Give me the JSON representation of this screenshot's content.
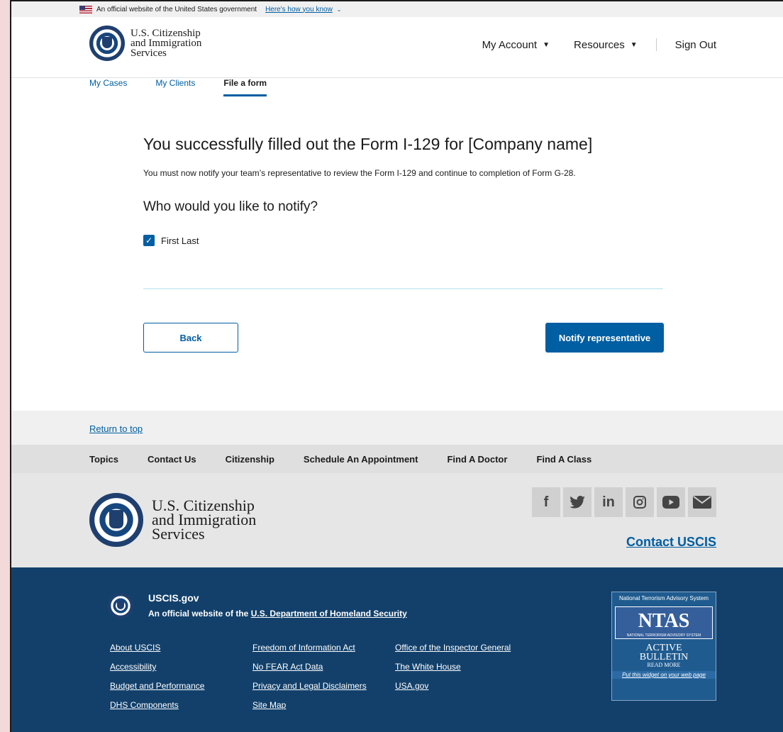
{
  "gov_banner": {
    "text": "An official website of the United States government",
    "link": "Here's how you know"
  },
  "header": {
    "logo_line1": "U.S. Citizenship",
    "logo_line2": "and Immigration",
    "logo_line3": "Services",
    "nav": {
      "my_account": "My Account",
      "resources": "Resources",
      "sign_out": "Sign Out"
    },
    "tabs": [
      {
        "label": "My Cases"
      },
      {
        "label": "My Clients"
      },
      {
        "label": "File a form",
        "active": true
      }
    ]
  },
  "main": {
    "title": "You successfully filled out the Form I-129 for [Company name]",
    "description": "You must now notify your team’s representative to review the Form I-129 and continue to completion of Form G-28.",
    "question": "Who would you like to notify?",
    "checkbox_label": "First Last",
    "checkbox_checked": true,
    "back_label": "Back",
    "notify_label": "Notify representative"
  },
  "footer": {
    "return_to_top": "Return to top",
    "nav": [
      "Topics",
      "Contact Us",
      "Citizenship",
      "Schedule An Appointment",
      "Find A Doctor",
      "Find A Class"
    ],
    "logo_line1": "U.S. Citizenship",
    "logo_line2": "and Immigration",
    "logo_line3": "Services",
    "social_icons": [
      "facebook-icon",
      "twitter-icon",
      "linkedin-icon",
      "instagram-icon",
      "youtube-icon",
      "email-icon"
    ],
    "contact_uscis": "Contact USCIS",
    "site_name": "USCIS.gov",
    "official_prefix": "An official website of the",
    "official_link": "U.S. Department of Homeland Security",
    "links_col1": [
      "About USCIS",
      "Accessibility",
      "Budget and Performance",
      "DHS Components"
    ],
    "links_col2": [
      "Freedom of Information Act",
      "No FEAR Act Data",
      "Privacy and Legal Disclaimers",
      "Site Map"
    ],
    "links_col3": [
      "Office of the Inspector General",
      "The White House",
      "USA.gov"
    ],
    "ntas": {
      "top": "National Terrorism Advisory System",
      "logo": "NTAS",
      "logo_sub": "NATIONAL TERRORISM ADVISORY SYSTEM",
      "active": "ACTIVE",
      "bulletin": "BULLETIN",
      "read_more": "READ MORE",
      "put": "Put this widget on your web page"
    }
  },
  "colors": {
    "primary": "#005ea2",
    "footer_blue": "#12406b"
  }
}
